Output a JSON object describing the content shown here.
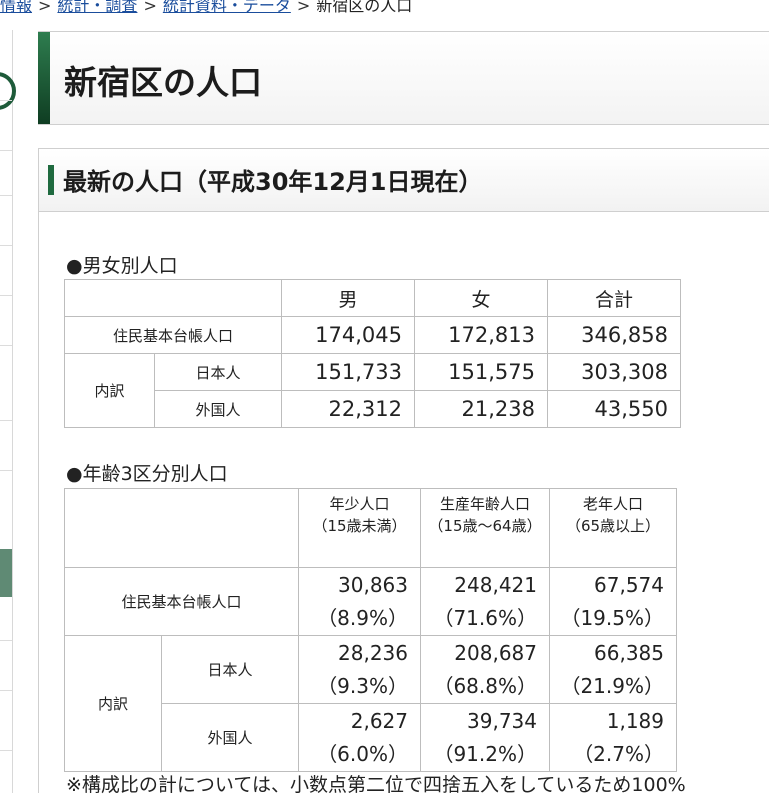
{
  "breadcrumb": {
    "items": [
      "情報",
      "統計・調査",
      "統計資料・データ"
    ],
    "current": "新宿区の人口",
    "separator": ">"
  },
  "page_title": "新宿区の人口",
  "section_title": "最新の人口（平成30年12月1日現在）",
  "gender_table": {
    "heading": "●男女別人口",
    "headers": [
      "男",
      "女",
      "合計"
    ],
    "row_total_label": "住民基本台帳人口",
    "row_total": [
      "174,045",
      "172,813",
      "346,858"
    ],
    "breakdown_label": "内訳",
    "rows": [
      {
        "label": "日本人",
        "values": [
          "151,733",
          "151,575",
          "303,308"
        ]
      },
      {
        "label": "外国人",
        "values": [
          "22,312",
          "21,238",
          "43,550"
        ]
      }
    ]
  },
  "age_table": {
    "heading": "●年齢3区分別人口",
    "headers": [
      {
        "title": "年少人口",
        "sub": "（15歳未満）"
      },
      {
        "title": "生産年齢人口",
        "sub": "（15歳～64歳）"
      },
      {
        "title": "老年人口",
        "sub": "（65歳以上）"
      }
    ],
    "row_total_label": "住民基本台帳人口",
    "row_total": [
      {
        "value": "30,863",
        "ratio": "（8.9%）"
      },
      {
        "value": "248,421",
        "ratio": "（71.6%）"
      },
      {
        "value": "67,574",
        "ratio": "（19.5%）"
      }
    ],
    "breakdown_label": "内訳",
    "rows": [
      {
        "label": "日本人",
        "values": [
          {
            "value": "28,236",
            "ratio": "（9.3%）"
          },
          {
            "value": "208,687",
            "ratio": "（68.8%）"
          },
          {
            "value": "66,385",
            "ratio": "（21.9%）"
          }
        ]
      },
      {
        "label": "外国人",
        "values": [
          {
            "value": "2,627",
            "ratio": "（6.0%）"
          },
          {
            "value": "39,734",
            "ratio": "（91.2%）"
          },
          {
            "value": "1,189",
            "ratio": "（2.7%）"
          }
        ]
      }
    ]
  },
  "note": "※構成比の計については、小数点第二位で四捨五入をしているため100%"
}
